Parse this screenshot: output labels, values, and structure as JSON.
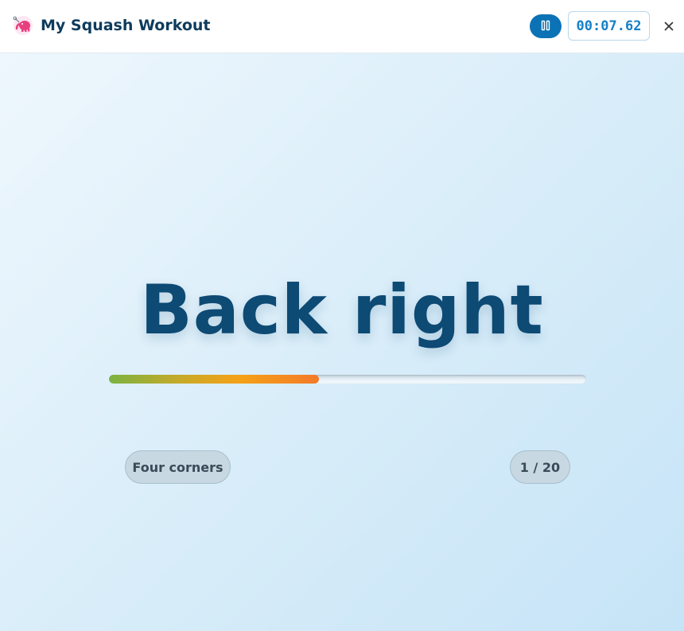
{
  "header": {
    "title": "My Squash Workout",
    "logo_icon": "elephant-squash-icon",
    "pause_icon": "pause-icon",
    "timer": "00:07.62",
    "close_icon": "close-icon"
  },
  "main": {
    "drill_name": "Back right",
    "progress_fraction": 0.44,
    "routine_name": "Four corners",
    "counter": "1 / 20"
  },
  "colors": {
    "brand": "#0b72b5",
    "title_text": "#0d4a74",
    "timer_text": "#1680c6",
    "progress_start": "#7bb241",
    "progress_end": "#f37a29"
  }
}
